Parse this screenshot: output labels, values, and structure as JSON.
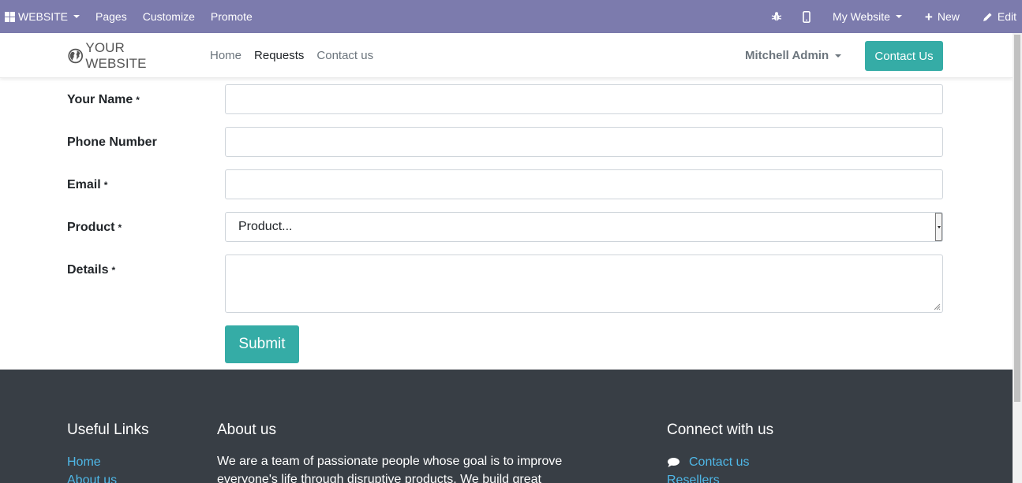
{
  "topbar": {
    "apps_label": "WEBSITE",
    "menu": [
      "Pages",
      "Customize",
      "Promote"
    ],
    "mywebsite_label": "My Website",
    "new_label": "New",
    "edit_label": "Edit"
  },
  "header": {
    "logo_text": "YOUR WEBSITE",
    "nav": [
      {
        "label": "Home"
      },
      {
        "label": "Requests"
      },
      {
        "label": "Contact us"
      }
    ],
    "user_name": "Mitchell Admin",
    "contact_button": "Contact Us"
  },
  "form": {
    "fields": [
      {
        "label": "Your Name",
        "required": "*",
        "value": ""
      },
      {
        "label": "Phone Number",
        "required": "",
        "value": ""
      },
      {
        "label": "Email",
        "required": "*",
        "value": ""
      },
      {
        "label": "Product",
        "required": "*",
        "selected": "Product..."
      },
      {
        "label": "Details",
        "required": "*",
        "value": ""
      }
    ],
    "submit_label": "Submit"
  },
  "footer": {
    "useful_links_title": "Useful Links",
    "useful_links": [
      "Home",
      "About us"
    ],
    "about_title": "About us",
    "about_text": "We are a team of passionate people whose goal is to improve everyone's life through disruptive products. We build great",
    "connect_title": "Connect with us",
    "connect_links": [
      "Contact us",
      "Resellers"
    ]
  },
  "colors": {
    "topbar": "#7c7bad",
    "accent": "#35aca6",
    "footer": "#383e45",
    "link": "#4fb8e8"
  }
}
